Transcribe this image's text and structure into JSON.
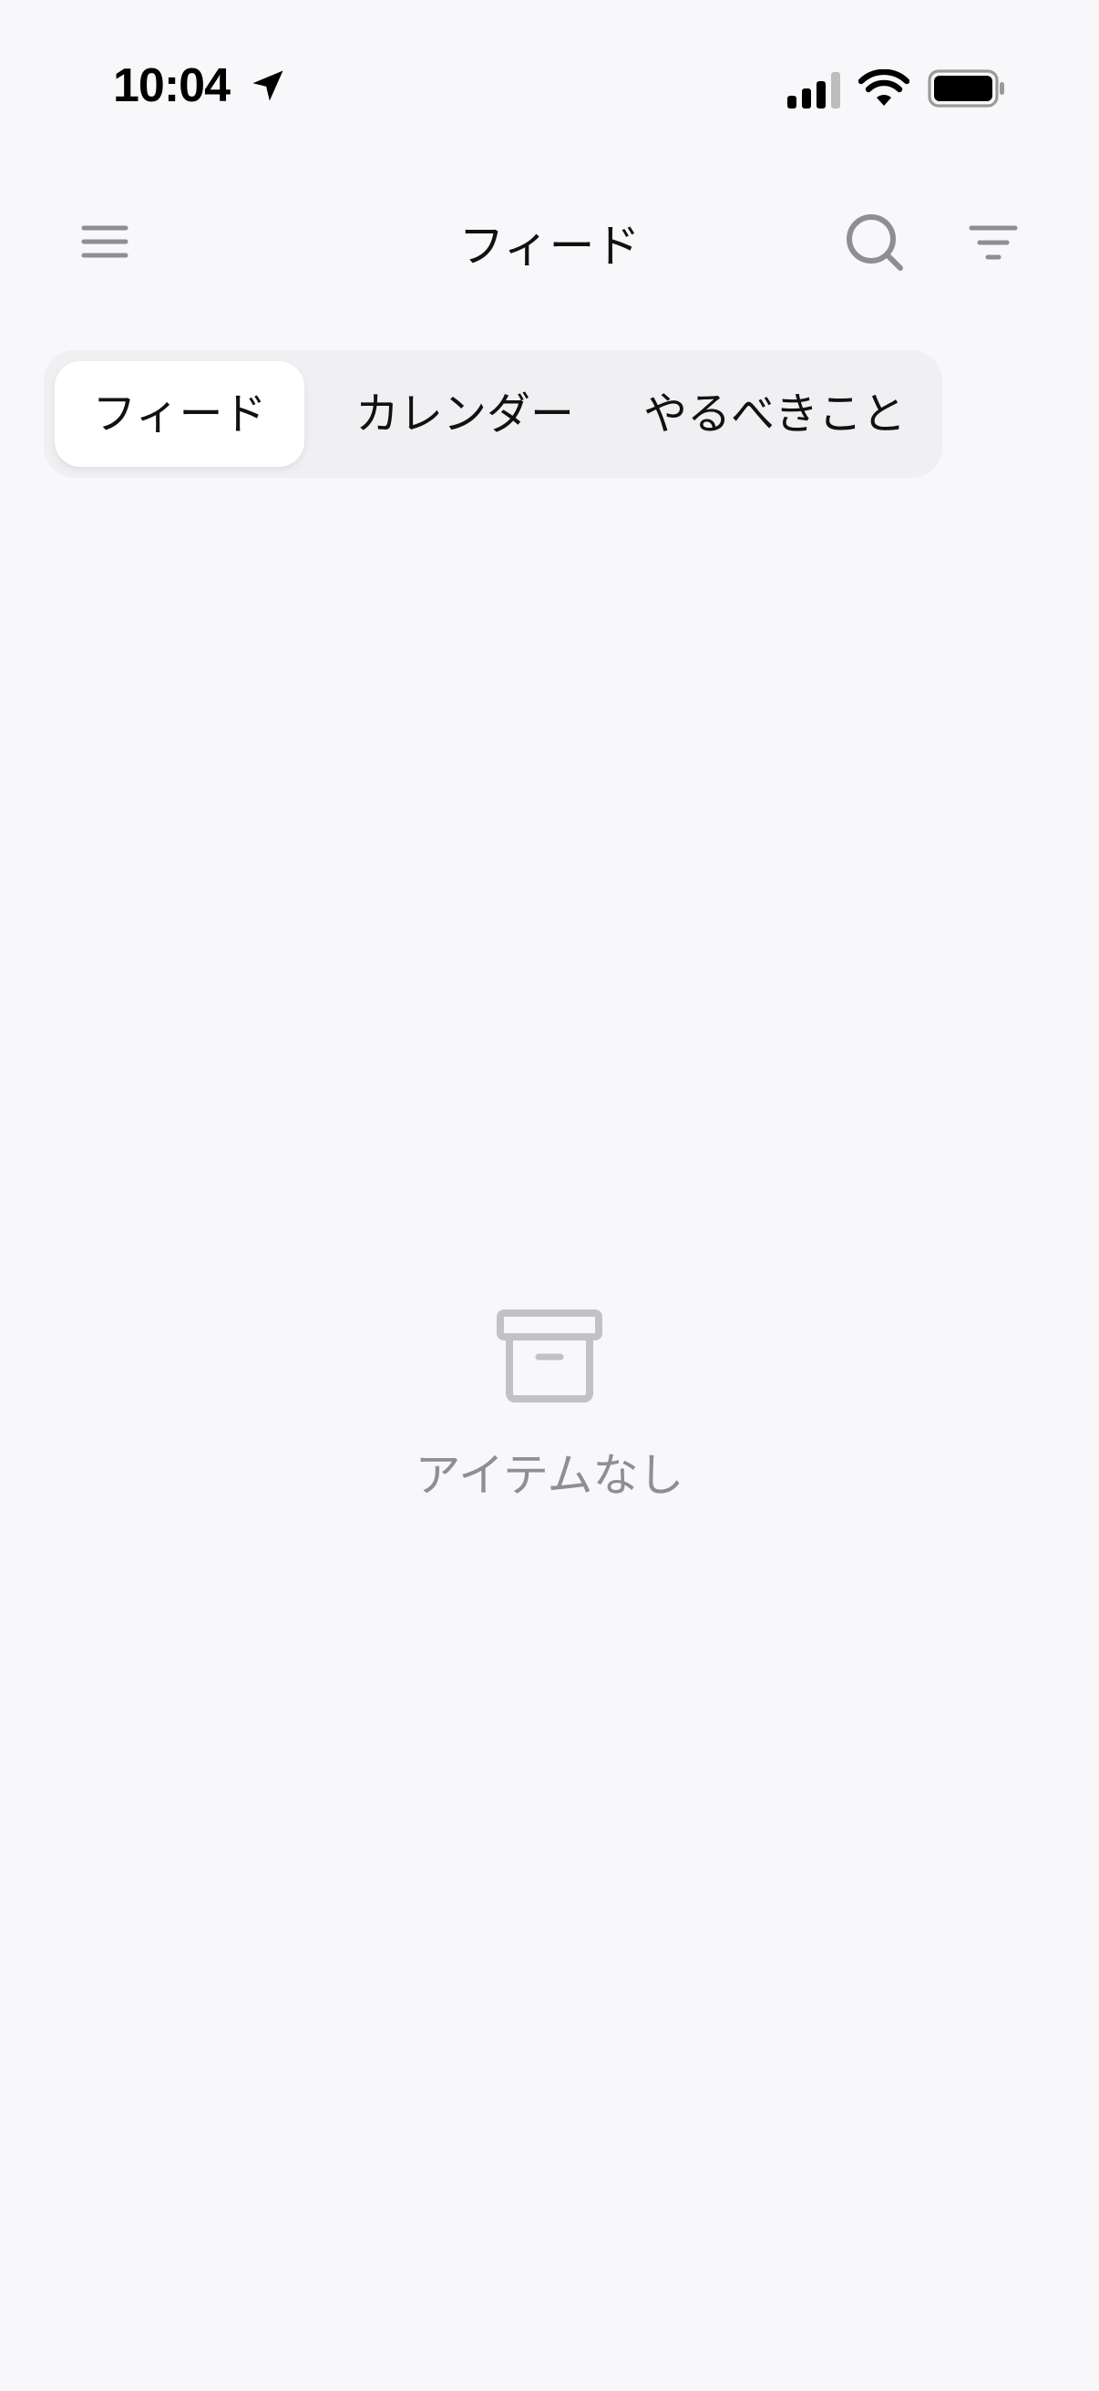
{
  "status_bar": {
    "time": "10:04"
  },
  "nav": {
    "title": "フィード"
  },
  "tabs": [
    {
      "label": "フィード",
      "selected": true
    },
    {
      "label": "カレンダー",
      "selected": false
    },
    {
      "label": "やるべきこと",
      "selected": false
    }
  ],
  "empty_state": {
    "icon": "archive-box-icon",
    "message": "アイテムなし"
  },
  "colors": {
    "background": "#f8f8fa",
    "segment_bg": "#f0f0f3",
    "icon_gray": "#8e8e93",
    "text_primary": "#111111"
  }
}
